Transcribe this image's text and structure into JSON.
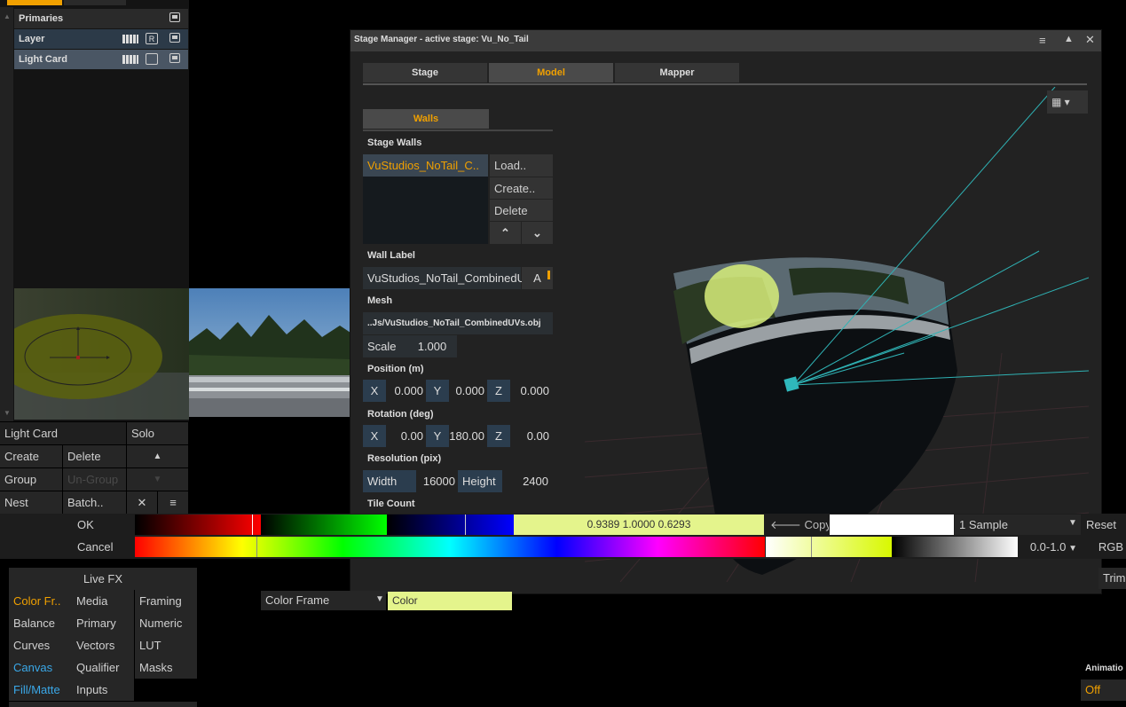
{
  "layers": {
    "header": "Primaries",
    "rows": [
      {
        "label": "Layer"
      },
      {
        "label": "Light Card"
      }
    ],
    "r_badge": "R"
  },
  "layer_controls": {
    "name": "Light Card",
    "solo": "Solo",
    "create": "Create",
    "delete": "Delete",
    "group": "Group",
    "ungroup": "Un-Group",
    "nest": "Nest",
    "batch": "Batch..",
    "up_arrow": "▲",
    "down_arrow": "▼",
    "close": "✕",
    "menu": "≡"
  },
  "stage_manager": {
    "title": "Stage Manager - active stage: Vu_No_Tail",
    "tabs": [
      "Stage",
      "Model",
      "Mapper"
    ],
    "active_tab": "Model",
    "subtab": "Walls",
    "stage_walls_label": "Stage Walls",
    "walls_list": [
      "VuStudios_NoTail_C.."
    ],
    "load": "Load..",
    "create": "Create..",
    "delete": "Delete",
    "wall_label_label": "Wall Label",
    "wall_label_value": "VuStudios_NoTail_CombinedU",
    "wall_label_btn": "A",
    "mesh_label": "Mesh",
    "mesh_value": "..Js/VuStudios_NoTail_CombinedUVs.obj",
    "scale_label": "Scale",
    "scale_value": "1.000",
    "position_label": "Position (m)",
    "position": {
      "x": "0.000",
      "y": "0.000",
      "z": "0.000"
    },
    "rotation_label": "Rotation (deg)",
    "rotation": {
      "x": "0.00",
      "y": "180.00",
      "z": "0.00"
    },
    "resolution_label": "Resolution (pix)",
    "width_label": "Width",
    "width_value": "16000",
    "height_label": "Height",
    "height_value": "2400",
    "tile_count_label": "Tile Count",
    "axis_x": "X",
    "axis_y": "Y",
    "axis_z": "Z"
  },
  "color_bar": {
    "ok": "OK",
    "cancel": "Cancel",
    "values": "0.9389  1.0000  0.6293",
    "copy": "Copy",
    "sample": "1 Sample",
    "reset": "Reset",
    "range": "0.0-1.0",
    "rgb": "RGB",
    "trim": "Trim",
    "swatch_color": "#e4f48c"
  },
  "live_fx": {
    "title": "Live FX",
    "grid": [
      [
        "Color Fr..",
        "Media",
        "Framing"
      ],
      [
        "Balance",
        "Primary",
        "Numeric"
      ],
      [
        "Curves",
        "Vectors",
        "LUT"
      ],
      [
        "Canvas",
        "Qualifier",
        "Masks"
      ],
      [
        "Fill/Matte",
        "Inputs",
        ""
      ]
    ]
  },
  "color_frame": {
    "dropdown": "Color Frame",
    "value": "Color"
  },
  "animation": {
    "label": "Animatio",
    "value": "Off"
  }
}
